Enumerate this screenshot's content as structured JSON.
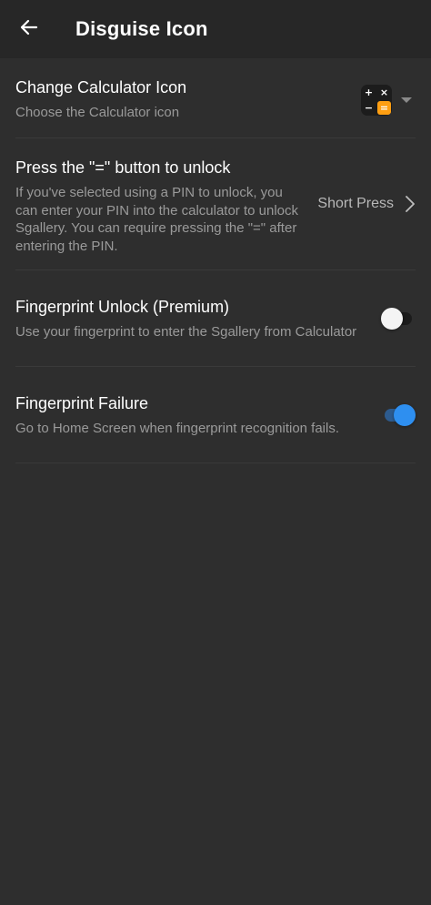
{
  "header": {
    "title": "Disguise Icon"
  },
  "colors": {
    "background": "#2e2e2e",
    "appbar": "#272727",
    "accent": "#2e8ff0",
    "calculator_orange": "#ff9f12"
  },
  "settings": {
    "calculator_icon": {
      "title": "Change Calculator Icon",
      "subtitle": "Choose the Calculator icon",
      "icon_keys": [
        "+",
        "×",
        "−",
        "="
      ]
    },
    "press_unlock": {
      "title": "Press the \"=\" button to unlock",
      "subtitle": "If you've selected using a PIN to unlock, you can enter your PIN into the calculator to unlock Sgallery. You can require pressing the \"=\" after entering the PIN.",
      "value": "Short Press"
    },
    "fingerprint_unlock": {
      "title": "Fingerprint Unlock (Premium)",
      "subtitle": "Use your fingerprint to enter the Sgallery from Calculator",
      "enabled": false
    },
    "fingerprint_failure": {
      "title": "Fingerprint Failure",
      "subtitle": "Go to Home Screen when fingerprint recognition fails.",
      "enabled": true
    }
  }
}
